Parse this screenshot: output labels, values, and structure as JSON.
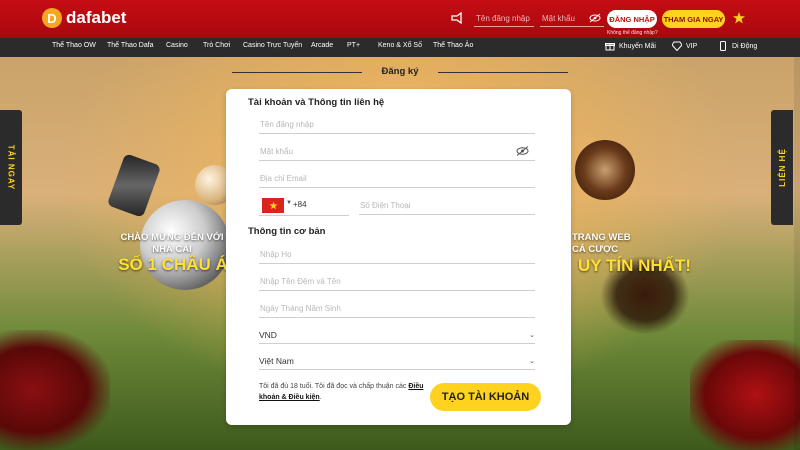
{
  "header": {
    "brand": "dafabet",
    "brand_mark": "D",
    "username_placeholder": "Tên đăng nhập",
    "password_placeholder": "Mật khẩu",
    "login_label": "ĐĂNG NHẬP",
    "forgot_label": "Không thể đăng nhập?",
    "join_label": "THAM GIA NGAY"
  },
  "nav": {
    "items": [
      "Thể Thao OW",
      "Thể Thao Dafa",
      "Casino",
      "Trò Chơi",
      "Casino Trực Tuyến",
      "Arcade",
      "PT+",
      "Keno & Xổ Số",
      "Thể Thao Ảo"
    ],
    "promotions": "Khuyến Mãi",
    "vip": "VIP",
    "mobile": "Di Động"
  },
  "side": {
    "left_tab": "TẢI NGAY",
    "right_tab": "LIÊN HỆ"
  },
  "promo": {
    "left_line1": "CHÀO MỪNG ĐẾN VỚI",
    "left_line2": "NHÀ CÁI",
    "left_line3": "SỐ 1 CHÂU Á",
    "right_line1": "TRANG WEB",
    "right_line2": "CÁ CƯỢC",
    "right_line3": "UY TÍN NHẤT!"
  },
  "form": {
    "page_title": "Đăng ký",
    "section_account": "Tài khoản và Thông tin liên hệ",
    "username_placeholder": "Tên đăng nhập",
    "password_placeholder": "Mật khẩu",
    "email_placeholder": "Địa chỉ Email",
    "dial_code": "+84",
    "phone_placeholder": "Số Điện Thoại",
    "section_basic": "Thông tin cơ bản",
    "lastname_placeholder": "Nhập Họ",
    "firstname_placeholder": "Nhập Tên Đệm và Tên",
    "dob_placeholder": "Ngày Tháng Năm Sinh",
    "currency_value": "VND",
    "country_value": "Việt Nam",
    "terms_text": "Tôi đã đủ 18 tuổi. Tôi đã đọc và chấp thuận các",
    "terms_link": "Điều khoản & Điều kiện",
    "terms_end": ".",
    "create_label": "TẠO TÀI KHOẢN"
  },
  "colors": {
    "brand_red": "#c40d14",
    "accent_yellow": "#ffd21f",
    "nav_dark": "#2b2b2b"
  }
}
